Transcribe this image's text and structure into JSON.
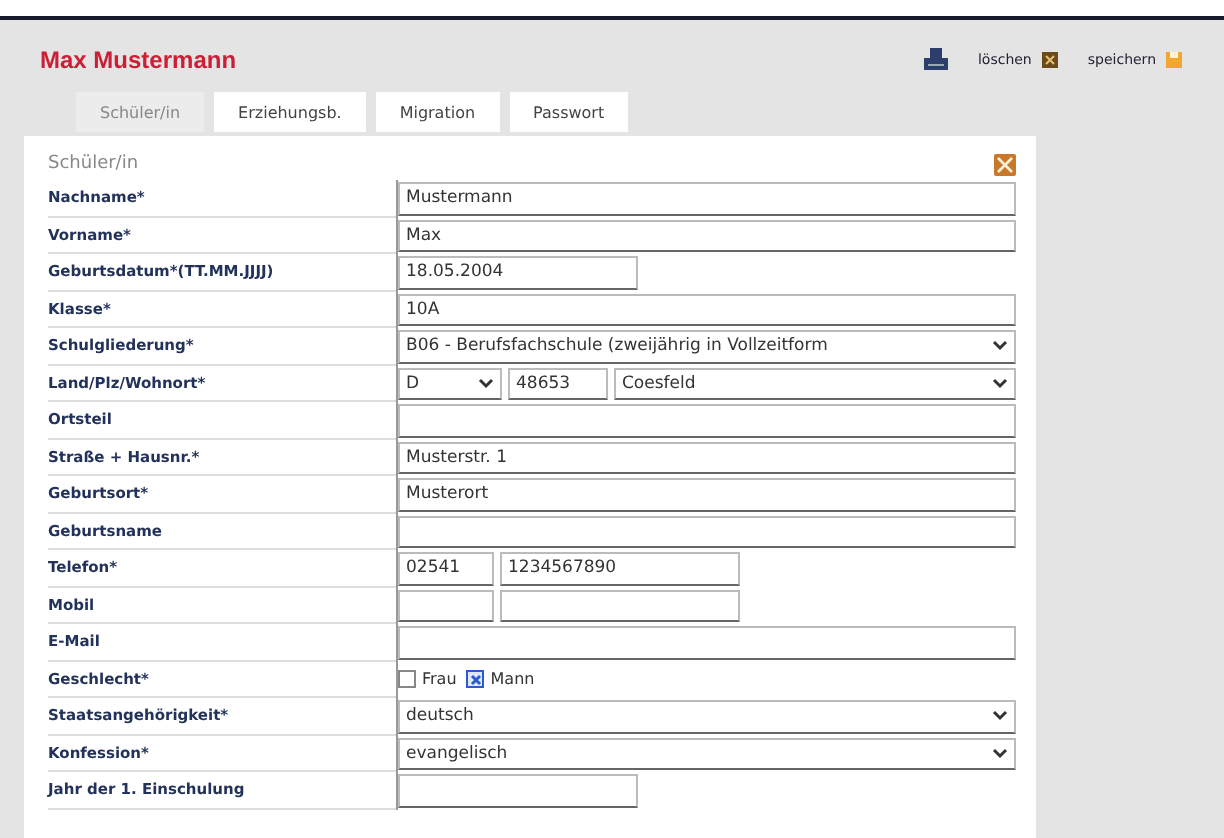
{
  "header": {
    "title": "Max Mustermann",
    "actions": [
      {
        "label": "löschen",
        "kind": "delete"
      },
      {
        "label": "speichern",
        "kind": "save"
      }
    ]
  },
  "tabs": [
    {
      "label": "Schüler/in",
      "selected": true
    },
    {
      "label": "Erziehungsb.",
      "selected": false
    },
    {
      "label": "Migration",
      "selected": false
    },
    {
      "label": "Passwort",
      "selected": false
    }
  ],
  "form": {
    "section": "Schüler/in",
    "fields": [
      {
        "kind": "text",
        "label": "Nachname*",
        "value": "Mustermann"
      },
      {
        "kind": "text",
        "label": "Vorname*",
        "value": "Max"
      },
      {
        "kind": "short",
        "label": "Geburtsdatum*(TT.MM.JJJJ)",
        "value": "18.05.2004"
      },
      {
        "kind": "text",
        "label": "Klasse*",
        "value": "10A"
      },
      {
        "kind": "select",
        "label": "Schulgliederung*",
        "value": "B06 - Berufsfachschule (zweijährig in Vollzeitform"
      },
      {
        "kind": "location",
        "label": "Land/Plz/Wohnort*",
        "country": "D",
        "zip": "48653",
        "city": "Coesfeld"
      },
      {
        "kind": "text",
        "label": "Ortsteil"
      },
      {
        "kind": "text",
        "label": "Straße + Hausnr.*",
        "value": "Musterstr. 1"
      },
      {
        "kind": "text",
        "label": "Geburtsort*",
        "value": "Musterort"
      },
      {
        "kind": "text",
        "label": "Geburtsname"
      },
      {
        "kind": "phone",
        "label": "Telefon*",
        "area": "02541",
        "number": "1234567890"
      },
      {
        "kind": "phone",
        "label": "Mobil"
      },
      {
        "kind": "text",
        "label": "E-Mail"
      },
      {
        "kind": "gender",
        "label": "Geschlecht*",
        "options": [
          {
            "label": "Frau",
            "selected": false
          },
          {
            "label": "Mann",
            "selected": true
          }
        ]
      },
      {
        "kind": "select",
        "label": "Staatsangehörigkeit*",
        "value": "deutsch"
      },
      {
        "kind": "select",
        "label": "Konfession*",
        "value": "evangelisch"
      },
      {
        "kind": "short",
        "label": "Jahr der 1. Einschulung"
      }
    ]
  }
}
